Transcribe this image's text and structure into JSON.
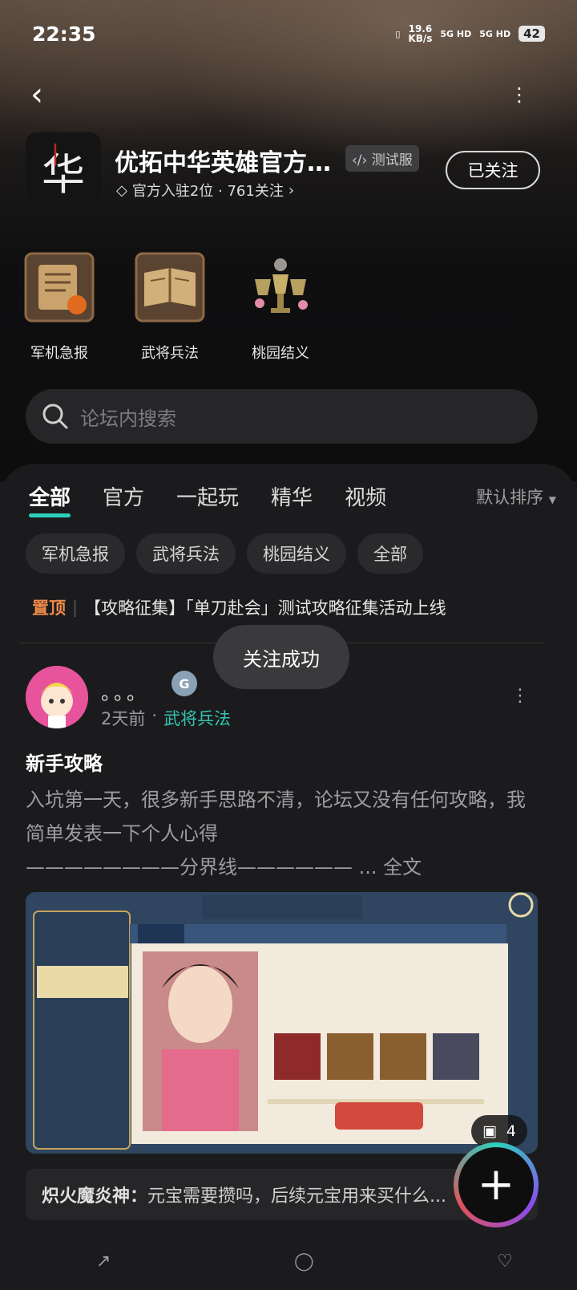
{
  "status_bar": {
    "time": "22:35",
    "net_speed_top": "19.6",
    "net_speed_bottom": "KB/s",
    "sim1": "5G HD",
    "sim2": "5G HD",
    "battery": "42"
  },
  "header": {
    "title": "优拓中华英雄官方…",
    "badge": "测试服",
    "subline": "官方入驻2位 · 761关注",
    "follow_label": "已关注",
    "logo_text": "华"
  },
  "categories": [
    {
      "label": "军机急报",
      "icon": "scroll-icon"
    },
    {
      "label": "武将兵法",
      "icon": "book-icon"
    },
    {
      "label": "桃园结义",
      "icon": "chalice-icon"
    }
  ],
  "search": {
    "placeholder": "论坛内搜索"
  },
  "tabs": [
    {
      "label": "全部"
    },
    {
      "label": "官方"
    },
    {
      "label": "一起玩"
    },
    {
      "label": "精华"
    },
    {
      "label": "视频"
    }
  ],
  "sort_label": "默认排序",
  "chips": [
    {
      "label": "军机急报"
    },
    {
      "label": "武将兵法"
    },
    {
      "label": "桃园结义"
    },
    {
      "label": "全部"
    }
  ],
  "pinned": {
    "tag": "置顶",
    "text": "【攻略征集】「单刀赴会」测试攻略征集活动上线"
  },
  "toast": "关注成功",
  "post": {
    "username": "。。。",
    "time": "2天前",
    "category": "武将兵法",
    "title": "新手攻略",
    "body": "入坑第一天，很多新手思路不清，论坛又没有任何攻略，我简单发表一下个人心得",
    "separator": "————————分界线——————",
    "more": "... 全文",
    "image_count": "4",
    "comment_author": "炽火魔炎神：",
    "comment_text": "元宝需要攒吗，后续元宝用来买什么..."
  },
  "colors": {
    "accent": "#2bd1bd",
    "pinned": "#ef8a4a"
  }
}
